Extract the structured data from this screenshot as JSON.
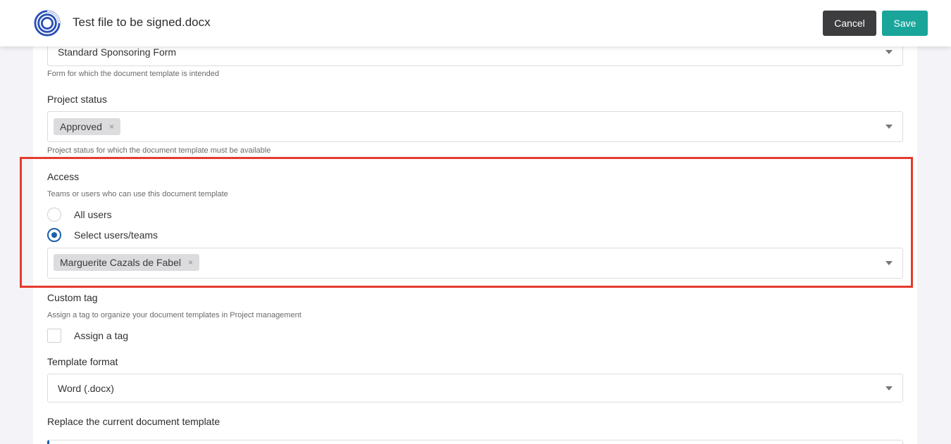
{
  "header": {
    "file_name": "Test file to be signed.docx",
    "cancel_label": "Cancel",
    "save_label": "Save",
    "logo_icon": "spiral-logo-icon"
  },
  "form": {
    "form_select": {
      "value": "Standard Sponsoring Form",
      "help": "Form for which the document template is intended"
    },
    "project_status": {
      "label": "Project status",
      "chips": [
        "Approved"
      ],
      "help": "Project status for which the document template must be available"
    },
    "access": {
      "label": "Access",
      "help": "Teams or users who can use this document template",
      "options": [
        {
          "label": "All users",
          "checked": false
        },
        {
          "label": "Select users/teams",
          "checked": true
        }
      ],
      "chips": [
        "Marguerite Cazals de Fabel"
      ]
    },
    "custom_tag": {
      "label": "Custom tag",
      "help": "Assign a tag to organize your document templates in Project management",
      "checkbox_label": "Assign a tag"
    },
    "template_format": {
      "label": "Template format",
      "value": "Word (.docx)"
    },
    "replace": {
      "label": "Replace the current document template"
    }
  },
  "colors": {
    "save": "#1aa59b",
    "cancel": "#3d3d3f",
    "highlight": "#e53a2e",
    "radio": "#1d5fa8",
    "logo": "#2a4fb5"
  },
  "chip_remove_glyph": "×"
}
